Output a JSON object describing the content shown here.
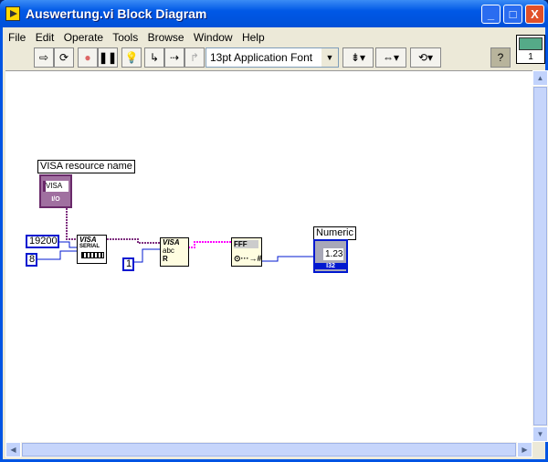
{
  "window": {
    "title": "Auswertung.vi Block Diagram",
    "minimize": "_",
    "maximize": "□",
    "close": "X"
  },
  "menu": [
    "File",
    "Edit",
    "Operate",
    "Tools",
    "Browse",
    "Window",
    "Help"
  ],
  "toolbar": {
    "font": "13pt Application Font",
    "help": "?",
    "vi_icon_number": "1"
  },
  "diagram": {
    "visa_label": "VISA resource name",
    "visa_control": "VISA",
    "visa_io": "I/O",
    "baud_const": "19200",
    "bits_const": "8",
    "bytes_const": "1",
    "serial_node": "VISA",
    "serial_sub": "SERIAL",
    "read_node": "VISA",
    "read_abc": "abc",
    "read_r": "R",
    "scan_node": "FFF",
    "numeric_label": "Numeric",
    "numeric_value": "1.23",
    "numeric_type": "I32"
  },
  "colors": {
    "visa_wire": "#7f2f7f",
    "string_wire": "#ff00ff",
    "int_wire": "#0018d0"
  }
}
